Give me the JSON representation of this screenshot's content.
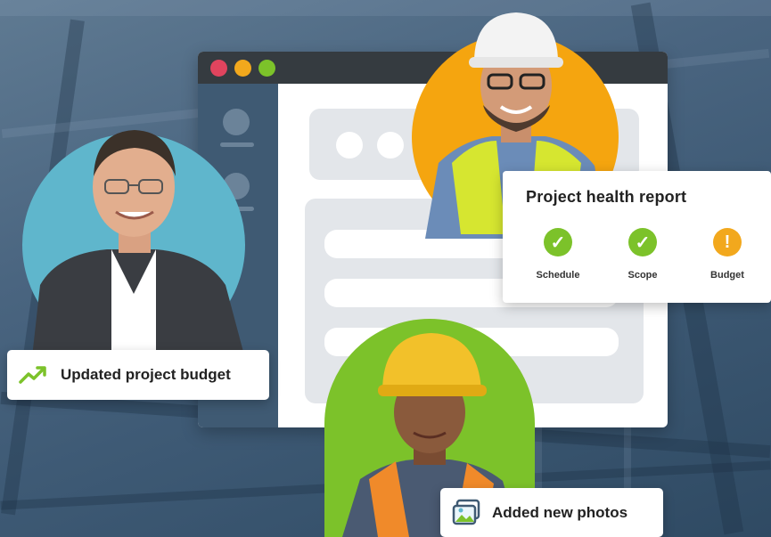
{
  "window": {
    "traffic_lights": [
      "#e0445e",
      "#f2a81d",
      "#7cc22a"
    ]
  },
  "report": {
    "title": "Project health report",
    "items": [
      {
        "label": "Schedule",
        "status": "ok",
        "icon": "check-circle-icon",
        "color": "#7cc22a"
      },
      {
        "label": "Scope",
        "status": "ok",
        "icon": "check-circle-icon",
        "color": "#7cc22a"
      },
      {
        "label": "Budget",
        "status": "warning",
        "icon": "exclamation-circle-icon",
        "color": "#f2a81d"
      }
    ]
  },
  "toasts": {
    "budget": {
      "label": "Updated project budget",
      "icon": "trend-up-icon"
    },
    "photos": {
      "label": "Added new photos",
      "icon": "photo-gallery-icon"
    }
  },
  "colors": {
    "green": "#7cc22a",
    "orange": "#f5a50f",
    "teal": "#5fb6cc",
    "navy": "#3f5a73"
  }
}
